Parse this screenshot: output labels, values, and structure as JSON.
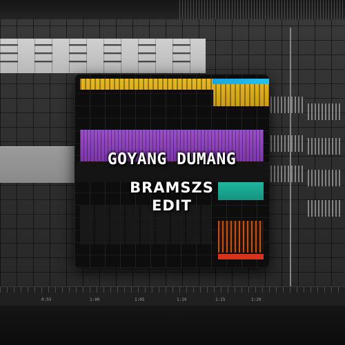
{
  "cover": {
    "title": "GOYANG DUMANG",
    "subtitle_line1": "BRAMSZS",
    "subtitle_line2": "EDIT"
  },
  "timeline": {
    "labels": [
      "0:55",
      "1:00",
      "1:05",
      "1:10",
      "1:15",
      "1:20"
    ]
  },
  "colors": {
    "yellow_clip": "#e8b824",
    "cyan_clip": "#23c3ee",
    "purple_clip": "#9a4fc7",
    "teal_clip": "#1fb59d",
    "orange_clip": "#e0621f",
    "red_clip": "#d6341c",
    "background": "#2e2e2e"
  }
}
